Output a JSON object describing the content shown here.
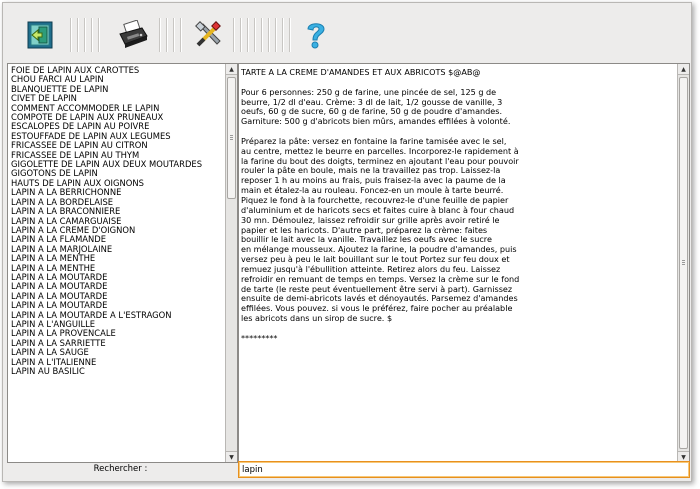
{
  "toolbar": {
    "buttons": [
      {
        "name": "exit-icon"
      },
      {
        "name": "printer-icon"
      },
      {
        "name": "tools-icon"
      },
      {
        "name": "help-icon"
      }
    ]
  },
  "recipe_list": {
    "items": [
      "FOIE DE LAPIN AUX CAROTTES",
      "CHOU FARCI AU LAPIN",
      "BLANQUETTE DE LAPIN",
      "CIVET DE LAPIN",
      "COMMENT ACCOMMODER LE LAPIN",
      "COMPOTE DE LAPIN AUX PRUNEAUX",
      "ESCALOPES DE LAPIN AU POIVRE",
      "ESTOUFFADE DE LAPIN AUX LEGUMES",
      "FRICASSEE DE LAPIN AU CITRON",
      "FRICASSEE DE LAPIN AU THYM",
      "GIGOLETTE DE LAPIN AUX DEUX MOUTARDES",
      "GIGOTONS DE LAPIN",
      "HAUTS DE LAPIN AUX OIGNONS",
      "LAPIN A LA BERRICHONNE",
      "LAPIN A LA BORDELAISE",
      "LAPIN A LA BRACONNIERE",
      "LAPIN A LA CAMARGUAISE",
      "LAPIN A LA CREME D'OIGNON",
      "LAPIN A LA FLAMANDE",
      "LAPIN A LA MARJOLAINE",
      "LAPIN A LA MENTHE",
      "LAPIN A LA MENTHE",
      "LAPIN A LA MOUTARDE",
      "LAPIN A LA MOUTARDE",
      "LAPIN A LA MOUTARDE",
      "LAPIN A LA MOUTARDE",
      "LAPIN A LA MOUTARDE A L'ESTRAGON",
      "LAPIN A L'ANGUILLE",
      "LAPIN A LA PROVENCALE",
      "LAPIN A LA SARRIETTE",
      "LAPIN A LA SAUGE",
      "LAPIN A L'ITALIENNE",
      "LAPIN AU BASILIC"
    ]
  },
  "recipe_text": {
    "lines": [
      "TARTE A LA CREME D'AMANDES ET AUX ABRICOTS $@AB@",
      "",
      "Pour 6 personnes: 250 g de farine, une pincée de sel, 125 g de",
      "beurre, 1/2 dl d'eau. Crème: 3 dl de lait, 1/2 gousse de vanille, 3",
      "oeufs, 60 g de sucre, 60 g de farine, 50 g de poudre d'amandes.",
      "Garniture: 500 g d'abricots bien mûrs, amandes effilées à volonté.",
      "",
      "Préparez la pâte: versez en fontaine la farine tamisée avec le sel,",
      "au centre, mettez le beurre en parcelles. Incorporez-le rapidement à",
      "la farine du bout des doigts, terminez en ajoutant l'eau pour pouvoir",
      "rouler la pâte en boule, mais ne la travaillez pas trop. Laissez-la",
      "reposer 1 h au moins au frais, puis fraisez-la avec la paume de la",
      "main et étalez-la au rouleau. Foncez-en un moule à tarte beurré.",
      "Piquez le fond à la fourchette, recouvrez-le d'une feuille de papier",
      "d'aluminium et de haricots secs et faites cuire à blanc à four chaud",
      "30 mn. Démoulez, laissez refroidir sur grille après avoir retiré le",
      "papier et les haricots. D'autre part, préparez la crème: faites",
      "bouillir le lait avec la vanille. Travaillez les oeufs avec le sucre",
      "en mélange mousseux. Ajoutez la farine, la poudre d'amandes, puis",
      "versez peu à peu le lait bouillant sur le tout Portez sur feu doux et",
      "remuez jusqu'à l'ébullition atteinte. Retirez alors du feu. Laissez",
      "refroidir en remuant de temps en temps. Versez la crème sur le fond",
      "de tarte (le reste peut éventuellement être servi à part). Garnissez",
      "ensuite de demi-abricots lavés et dénoyautés. Parsemez d'amandes",
      "effilées. Vous pouvez. si vous le préférez, faire pocher au préalable",
      "les abricots dans un sirop de sucre. $",
      "",
      "*********"
    ]
  },
  "search": {
    "label": "Rechercher :",
    "value": "lapin"
  },
  "colors": {
    "window_bg": "#edeceb",
    "search_focus_border": "#e8901e",
    "help_icon": "#3ab0e2"
  }
}
